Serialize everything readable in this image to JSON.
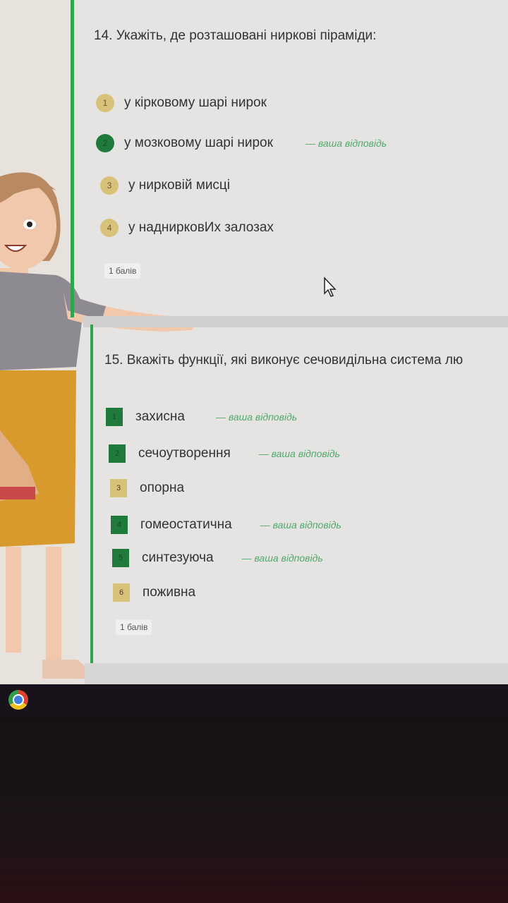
{
  "colors": {
    "correct": "#1f7a3c",
    "neutral": "#d8c27a",
    "accent": "#2fa64e",
    "answer_note": "#4fa96b"
  },
  "q14": {
    "title": "14. Укажіть, де розташовані ниркові піраміди:",
    "options": [
      {
        "num": "1",
        "label": "у кірковому шарі нирок",
        "state": "neutral",
        "note": ""
      },
      {
        "num": "2",
        "label": "у мозковому шарі нирок",
        "state": "correct",
        "note": "— ваша відповідь"
      },
      {
        "num": "3",
        "label": "у нирковій мисці",
        "state": "neutral",
        "note": ""
      },
      {
        "num": "4",
        "label": "у наднирковИх залозах",
        "state": "neutral",
        "note": ""
      }
    ],
    "points": "1 балів"
  },
  "q15": {
    "title": "15. Вкажіть функції, які виконує сечовидільна система лю",
    "options": [
      {
        "num": "1",
        "label": "захисна",
        "state": "correct",
        "note": "— ваша відповідь"
      },
      {
        "num": "2",
        "label": "сечоутворення",
        "state": "correct",
        "note": "— ваша відповідь"
      },
      {
        "num": "3",
        "label": "опорна",
        "state": "neutral",
        "note": ""
      },
      {
        "num": "4",
        "label": "гомеостатична",
        "state": "correct",
        "note": "— ваша відповідь"
      },
      {
        "num": "5",
        "label": "синтезуюча",
        "state": "correct",
        "note": "— ваша відповідь"
      },
      {
        "num": "6",
        "label": "поживна",
        "state": "neutral",
        "note": ""
      }
    ],
    "points": "1 балів"
  },
  "icons": {
    "cursor": "mouse-pointer-icon",
    "taskbar": "chrome-icon",
    "illustration": "teacher-illustration"
  }
}
